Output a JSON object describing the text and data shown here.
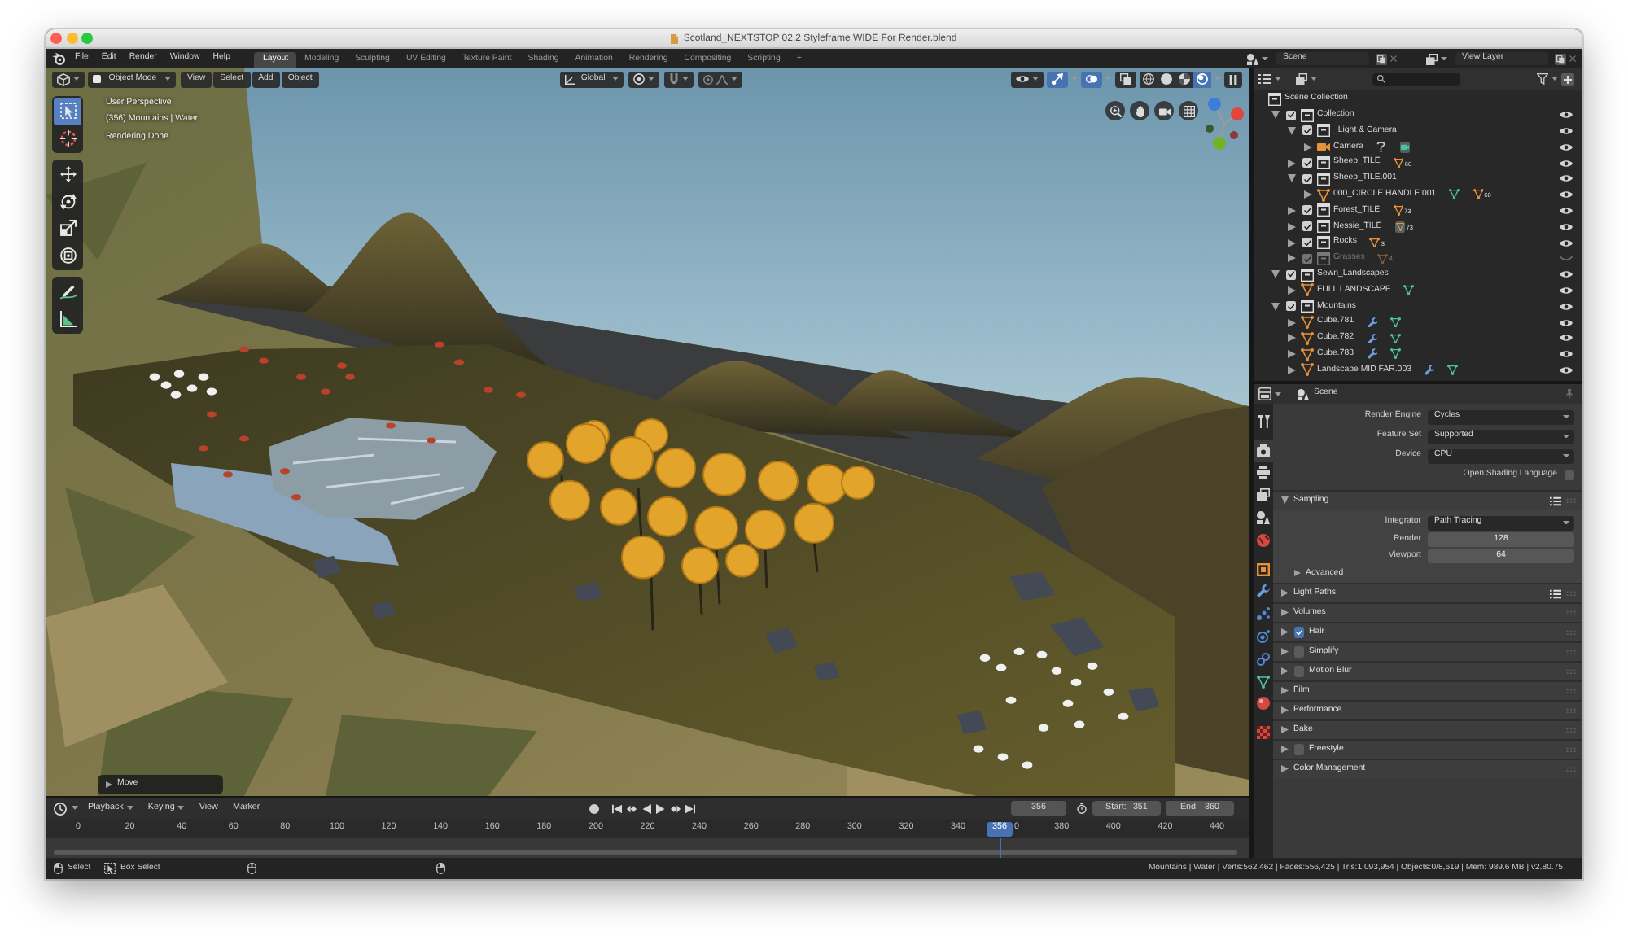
{
  "window": {
    "title": "Scotland_NEXTSTOP 02.2 Styleframe WIDE For Render.blend"
  },
  "topbar": {
    "menus": [
      "File",
      "Edit",
      "Render",
      "Window",
      "Help"
    ],
    "workspaces": [
      {
        "label": "Layout",
        "selected": true
      },
      {
        "label": "Modeling",
        "selected": false
      },
      {
        "label": "Sculpting",
        "selected": false
      },
      {
        "label": "UV Editing",
        "selected": false
      },
      {
        "label": "Texture Paint",
        "selected": false
      },
      {
        "label": "Shading",
        "selected": false
      },
      {
        "label": "Animation",
        "selected": false
      },
      {
        "label": "Rendering",
        "selected": false
      },
      {
        "label": "Compositing",
        "selected": false
      },
      {
        "label": "Scripting",
        "selected": false
      }
    ],
    "add_workspace": "+",
    "scene": "Scene",
    "view_layer": "View Layer"
  },
  "viewport": {
    "header": {
      "mode": "Object Mode",
      "menus": [
        "View",
        "Select",
        "Add",
        "Object"
      ],
      "orientation": "Global",
      "toggles": [
        {
          "kind": "gizmos",
          "on": true
        },
        {
          "kind": "overlays",
          "on": true
        },
        {
          "kind": "xray",
          "on": false
        }
      ],
      "shading": [
        {
          "kind": "wireframe",
          "selected": false
        },
        {
          "kind": "solid",
          "selected": false
        },
        {
          "kind": "material",
          "selected": false
        },
        {
          "kind": "rendered",
          "selected": true
        }
      ]
    },
    "tools": [
      [
        {
          "kind": "select_box",
          "selected": true
        },
        {
          "kind": "cursor",
          "selected": false
        }
      ],
      [
        {
          "kind": "move",
          "selected": false
        },
        {
          "kind": "rotate",
          "selected": false
        },
        {
          "kind": "scale",
          "selected": false
        },
        {
          "kind": "transform",
          "selected": false
        }
      ],
      [
        {
          "kind": "annotate",
          "selected": false
        },
        {
          "kind": "measure",
          "selected": false
        }
      ]
    ],
    "info": [
      "User Perspective",
      "(356) Mountains | Water",
      "Rendering Done"
    ],
    "last_operator": {
      "label": "Move",
      "expanded": false
    }
  },
  "outliner": {
    "root": "Scene Collection",
    "items": [
      {
        "name": "Collection",
        "kind": "collection",
        "expanded": true,
        "checked": true,
        "visible": true,
        "children": [
          {
            "name": "_Light & Camera",
            "kind": "collection",
            "expanded": true,
            "checked": true,
            "visible": true,
            "children": [
              {
                "name": "Camera",
                "kind": "camera",
                "expanded": false,
                "visible": true,
                "extras": [
                  {
                    "kind": "constraint",
                    "active": false
                  },
                  {
                    "kind": "camera_data",
                    "active": true
                  }
                ]
              }
            ]
          },
          {
            "name": "Sheep_TILE",
            "kind": "collection",
            "expanded": false,
            "checked": true,
            "visible": true,
            "extras": [
              {
                "kind": "objects",
                "count": "60",
                "active": false
              }
            ]
          },
          {
            "name": "Sheep_TILE.001",
            "kind": "collection",
            "expanded": true,
            "checked": true,
            "visible": true,
            "children": [
              {
                "name": "000_CIRCLE HANDLE.001",
                "kind": "mesh",
                "expanded": false,
                "visible": true,
                "extras": [
                  {
                    "kind": "mesh_data",
                    "active": false
                  },
                  {
                    "kind": "objects",
                    "count": "60",
                    "active": false
                  }
                ]
              }
            ]
          },
          {
            "name": "Forest_TILE",
            "kind": "collection",
            "expanded": false,
            "checked": true,
            "visible": true,
            "extras": [
              {
                "kind": "objects",
                "count": "73",
                "active": false
              }
            ]
          },
          {
            "name": "Nessie_TILE",
            "kind": "collection",
            "expanded": false,
            "checked": true,
            "visible": true,
            "extras": [
              {
                "kind": "objects",
                "count": "73",
                "active": true
              }
            ]
          },
          {
            "name": "Rocks",
            "kind": "collection",
            "expanded": false,
            "checked": true,
            "visible": true,
            "extras": [
              {
                "kind": "objects",
                "count": "3",
                "active": false
              }
            ]
          },
          {
            "name": "Grasses",
            "kind": "collection",
            "expanded": false,
            "checked": true,
            "visible": false,
            "extras": [
              {
                "kind": "objects",
                "count": "4",
                "active": false
              }
            ]
          }
        ]
      },
      {
        "name": "Sewn_Landscapes",
        "kind": "collection",
        "expanded": true,
        "checked": true,
        "visible": true,
        "children": [
          {
            "name": "FULL LANDSCAPE",
            "kind": "mesh",
            "expanded": false,
            "visible": true,
            "extras": [
              {
                "kind": "mesh_data",
                "active": false
              }
            ]
          }
        ]
      },
      {
        "name": "Mountains",
        "kind": "collection",
        "expanded": true,
        "checked": true,
        "visible": true,
        "children": [
          {
            "name": "Cube.781",
            "kind": "mesh",
            "expanded": false,
            "visible": true,
            "extras": [
              {
                "kind": "modifier",
                "active": false
              },
              {
                "kind": "mesh_data",
                "active": false
              }
            ]
          },
          {
            "name": "Cube.782",
            "kind": "mesh",
            "expanded": false,
            "visible": true,
            "extras": [
              {
                "kind": "modifier",
                "active": false
              },
              {
                "kind": "mesh_data",
                "active": false
              }
            ]
          },
          {
            "name": "Cube.783",
            "kind": "mesh",
            "expanded": false,
            "visible": true,
            "extras": [
              {
                "kind": "modifier",
                "active": false
              },
              {
                "kind": "mesh_data",
                "active": false
              }
            ]
          },
          {
            "name": "Landscape MID FAR.003",
            "kind": "mesh",
            "expanded": false,
            "visible": true,
            "extras": [
              {
                "kind": "modifier",
                "active": false
              },
              {
                "kind": "mesh_data",
                "active": false
              }
            ]
          }
        ]
      }
    ]
  },
  "properties": {
    "context": "Scene",
    "tabs": [
      [
        {
          "kind": "tool",
          "selected": false
        }
      ],
      [
        {
          "kind": "render",
          "selected": true
        },
        {
          "kind": "output",
          "selected": false
        },
        {
          "kind": "view_layer",
          "selected": false
        },
        {
          "kind": "scene",
          "selected": false
        },
        {
          "kind": "world",
          "selected": false
        }
      ],
      [
        {
          "kind": "object",
          "selected": false
        },
        {
          "kind": "modifiers",
          "selected": false
        },
        {
          "kind": "particles",
          "selected": false
        },
        {
          "kind": "physics",
          "selected": false
        },
        {
          "kind": "constraints",
          "selected": false
        },
        {
          "kind": "data",
          "selected": false
        },
        {
          "kind": "material",
          "selected": false
        }
      ],
      [
        {
          "kind": "texture",
          "selected": false
        }
      ]
    ],
    "rows": [
      {
        "kind": "dropdown",
        "label": "Render Engine",
        "value": "Cycles"
      },
      {
        "kind": "dropdown",
        "label": "Feature Set",
        "value": "Supported"
      },
      {
        "kind": "dropdown",
        "label": "Device",
        "value": "CPU"
      },
      {
        "kind": "checkbox",
        "label": "Open Shading Language",
        "checked": false
      }
    ],
    "panels": [
      {
        "title": "Sampling",
        "kind": "plain",
        "expanded": true,
        "presets": true,
        "rows": [
          {
            "kind": "dropdown",
            "label": "Integrator",
            "value": "Path Tracing"
          },
          {
            "kind": "number",
            "label": "Render",
            "value": "128"
          },
          {
            "kind": "number",
            "label": "Viewport",
            "value": "64"
          }
        ],
        "subpanels": [
          {
            "title": "Advanced",
            "expanded": false
          }
        ]
      },
      {
        "title": "Light Paths",
        "kind": "plain",
        "expanded": false,
        "presets": true
      },
      {
        "title": "Volumes",
        "kind": "plain",
        "expanded": false,
        "presets": false
      },
      {
        "title": "Hair",
        "kind": "toggle",
        "checked": true,
        "expanded": false,
        "presets": false
      },
      {
        "title": "Simplify",
        "kind": "toggle",
        "checked": false,
        "expanded": false,
        "presets": false
      },
      {
        "title": "Motion Blur",
        "kind": "toggle",
        "checked": false,
        "expanded": false,
        "presets": false
      },
      {
        "title": "Film",
        "kind": "plain",
        "expanded": false,
        "presets": false
      },
      {
        "title": "Performance",
        "kind": "plain",
        "expanded": false,
        "presets": false
      },
      {
        "title": "Bake",
        "kind": "plain",
        "expanded": false,
        "presets": false
      },
      {
        "title": "Freestyle",
        "kind": "toggle",
        "checked": false,
        "expanded": false,
        "presets": false
      },
      {
        "title": "Color Management",
        "kind": "plain",
        "expanded": false,
        "presets": false
      }
    ]
  },
  "timeline": {
    "menus": [
      {
        "label": "Playback",
        "dropdown": true
      },
      {
        "label": "Keying",
        "dropdown": true
      },
      {
        "label": "View",
        "dropdown": false
      },
      {
        "label": "Marker",
        "dropdown": false
      }
    ],
    "auto_keying": false,
    "frame": "356",
    "start": {
      "label": "Start:",
      "value": "351"
    },
    "end": {
      "label": "End:",
      "value": "360"
    },
    "ruler": {
      "ticks": [
        "0",
        "20",
        "40",
        "60",
        "80",
        "100",
        "120",
        "140",
        "160",
        "180",
        "200",
        "220",
        "240",
        "260",
        "280",
        "300",
        "320",
        "340",
        "0",
        "380",
        "400",
        "420",
        "440"
      ],
      "current": "356"
    }
  },
  "status_bar": {
    "hints": [
      {
        "kind": "mouse_left",
        "label": "Select"
      },
      {
        "kind": "box_select",
        "label": "Box Select"
      },
      {
        "kind": "mouse_middle"
      },
      {
        "kind": "mouse_right"
      }
    ],
    "stats": "Mountains | Water | Verts:562,462 | Faces:556,425 | Tris:1,093,954 | Objects:0/8,619 | Mem: 989.6 MB | v2.80.75"
  }
}
